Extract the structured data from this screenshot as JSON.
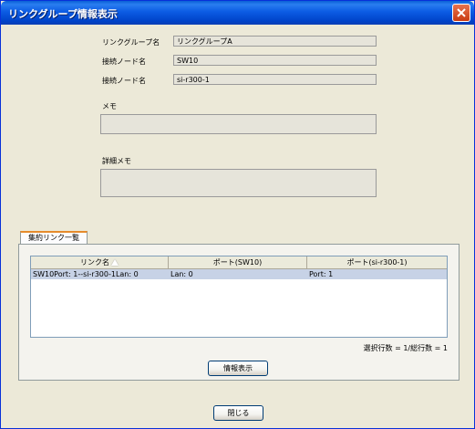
{
  "window": {
    "title": "リンクグループ情報表示",
    "close_label": "✕"
  },
  "form": {
    "group_name_label": "リンクグループ名",
    "group_name_value": "リンクグループA",
    "node1_label": "接続ノード名",
    "node1_value": "SW10",
    "node2_label": "接続ノード名",
    "node2_value": "si-r300-1",
    "memo_label": "メモ",
    "memo_value": "",
    "detail_memo_label": "詳細メモ",
    "detail_memo_value": ""
  },
  "tab": {
    "label": "集約リンク一覧"
  },
  "table": {
    "columns": [
      "リンク名",
      "ポート(SW10)",
      "ポート(si-r300-1)"
    ],
    "rows": [
      [
        "SW10Port: 1--si-r300-1Lan: 0",
        "Lan: 0",
        "Port: 1"
      ]
    ]
  },
  "selection_count": "選択行数 = 1/総行数 = 1",
  "buttons": {
    "info": "情報表示",
    "close": "閉じる"
  }
}
